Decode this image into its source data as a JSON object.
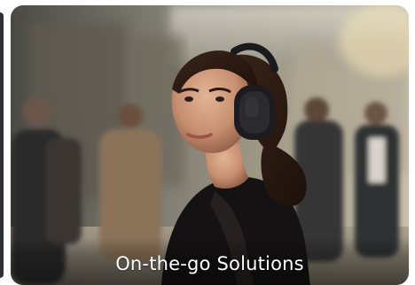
{
  "carousel": {
    "cards": [
      {
        "caption": "On-the-go Solutions",
        "image_subject": "woman-wearing-headphones-on-street"
      }
    ]
  },
  "colors": {
    "caption_text": "#ffffff",
    "peek_card": "#2c2f35"
  }
}
